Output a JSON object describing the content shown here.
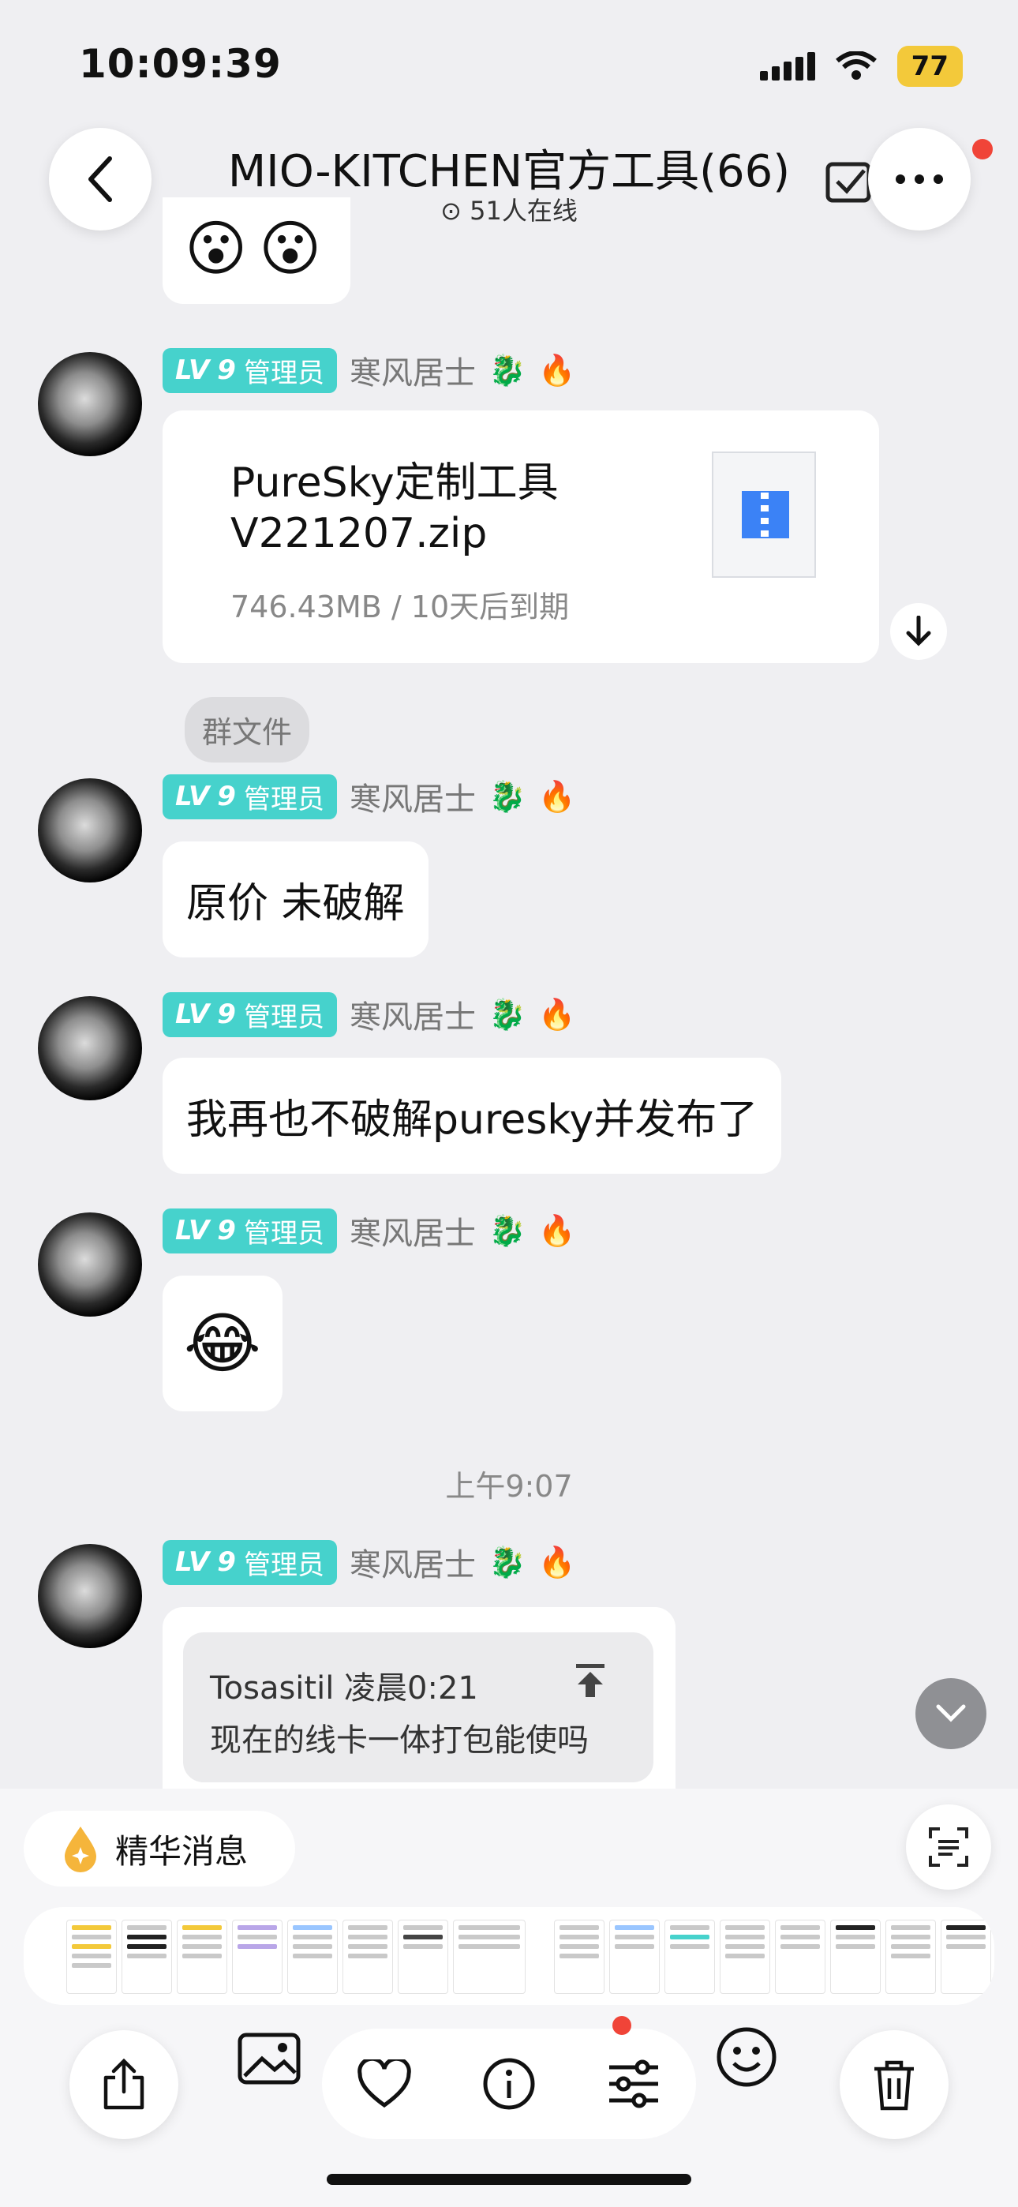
{
  "status_bar": {
    "time": "10:09:39",
    "battery": "77"
  },
  "header": {
    "title": "MIO-KITCHEN官方工具(66)",
    "online": "51人在线"
  },
  "messages": [
    {
      "type": "file",
      "level": "9",
      "role": "管理员",
      "sender": "寒风居士",
      "file_name_line1": "PureSky定制工具",
      "file_name_line2": "V221207.zip",
      "file_meta": "746.43MB / 10天后到期",
      "tag": "群文件"
    },
    {
      "type": "text",
      "level": "9",
      "role": "管理员",
      "sender": "寒风居士",
      "text": "原价 未破解"
    },
    {
      "type": "text",
      "level": "9",
      "role": "管理员",
      "sender": "寒风居士",
      "text": "我再也不破解puresky并发布了"
    },
    {
      "type": "emoji",
      "level": "9",
      "role": "管理员",
      "sender": "寒风居士",
      "emoji": "😂"
    },
    {
      "type": "reply",
      "level": "9",
      "role": "管理员",
      "sender": "寒风居士",
      "quote_author": "Tosasitil 凌晨0:21",
      "quote_text": "现在的线卡一体打包能使吗"
    }
  ],
  "time_separator": "上午9:07",
  "essence_label": "精华消息",
  "icons": {
    "back": "chevron-left-icon",
    "more": "more-icon",
    "online": "check-circle-icon",
    "download": "download-icon",
    "scroll": "chevron-down-icon",
    "scan": "scan-icon",
    "share": "share-icon",
    "photo": "photo-icon",
    "like": "heart-icon",
    "info": "info-icon",
    "adjust": "sliders-icon",
    "emoji": "smile-icon",
    "delete": "trash-icon"
  },
  "colors": {
    "level_badge": "#46d2cc",
    "battery": "#f3c93a",
    "badge_dot": "#f04438",
    "file_icon": "#3b82f6"
  }
}
